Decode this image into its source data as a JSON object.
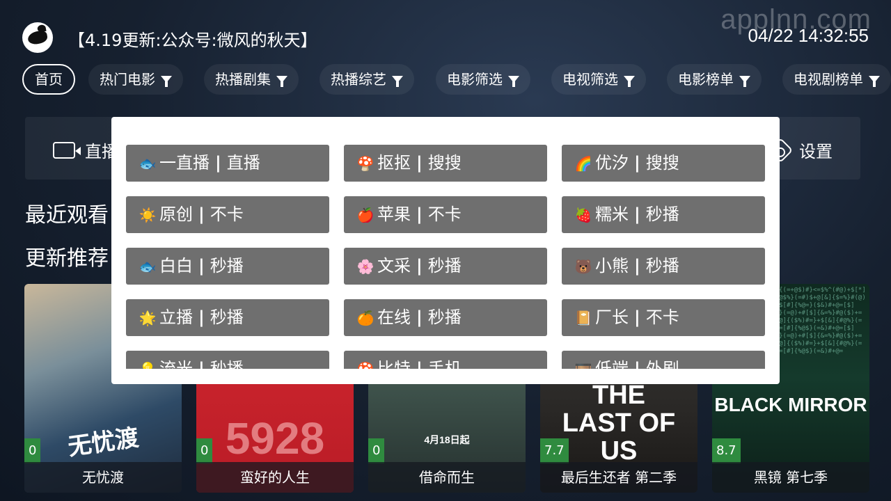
{
  "watermark": "applnn.com",
  "header": {
    "notice": "【4.19更新:公众号:微风的秋天】",
    "datetime": "04/22 14:32:55"
  },
  "nav": {
    "items": [
      {
        "label": "首页",
        "active": true,
        "filter": false
      },
      {
        "label": "热门电影",
        "filter": true
      },
      {
        "label": "热播剧集",
        "filter": true
      },
      {
        "label": "热播综艺",
        "filter": true
      },
      {
        "label": "电影筛选",
        "filter": true
      },
      {
        "label": "电视筛选",
        "filter": true
      },
      {
        "label": "电影榜单",
        "filter": true
      },
      {
        "label": "电视剧榜单",
        "filter": true
      }
    ]
  },
  "quickbar": {
    "left_label": "直播",
    "right_label": "设置"
  },
  "sections": {
    "recent": "最近观看",
    "recommend": "更新推荐"
  },
  "posters": [
    {
      "title": "无忧渡",
      "score": "0",
      "art": "无忧渡"
    },
    {
      "title": "蛮好的人生",
      "score": "0",
      "art": "5928"
    },
    {
      "title": "借命而生",
      "score": "0",
      "art": "4月18日起"
    },
    {
      "title": "最后生还者 第二季",
      "score": "7.7",
      "art": "THE LAST OF US"
    },
    {
      "title": "黑镜 第七季",
      "score": "8.7",
      "art": "BLACK MIRROR"
    }
  ],
  "sources": [
    {
      "icon": "🐟",
      "name": "一直播",
      "tag": "直播"
    },
    {
      "icon": "🍄",
      "name": "抠抠",
      "tag": "搜搜"
    },
    {
      "icon": "🌈",
      "name": "优汐",
      "tag": "搜搜"
    },
    {
      "icon": "☀️",
      "name": "原创",
      "tag": "不卡"
    },
    {
      "icon": "🍎",
      "name": "苹果",
      "tag": "不卡"
    },
    {
      "icon": "🍓",
      "name": "糯米",
      "tag": "秒播"
    },
    {
      "icon": "🐟",
      "name": "白白",
      "tag": "秒播"
    },
    {
      "icon": "🌸",
      "name": "文采",
      "tag": "秒播"
    },
    {
      "icon": "🐻",
      "name": "小熊",
      "tag": "秒播"
    },
    {
      "icon": "🌟",
      "name": "立播",
      "tag": "秒播"
    },
    {
      "icon": "🍊",
      "name": "在线",
      "tag": "秒播"
    },
    {
      "icon": "📔",
      "name": "厂长",
      "tag": "不卡"
    },
    {
      "icon": "💡",
      "name": "流光",
      "tag": "秒播"
    },
    {
      "icon": "🍄",
      "name": "比特",
      "tag": "手机"
    },
    {
      "icon": "🎞️",
      "name": "低端",
      "tag": "外剧"
    }
  ],
  "colors": {
    "background": "#16202f",
    "score_badge": "#2f8b3f",
    "source_button": "#6f6f6f",
    "dialog_bg": "#ffffff"
  }
}
